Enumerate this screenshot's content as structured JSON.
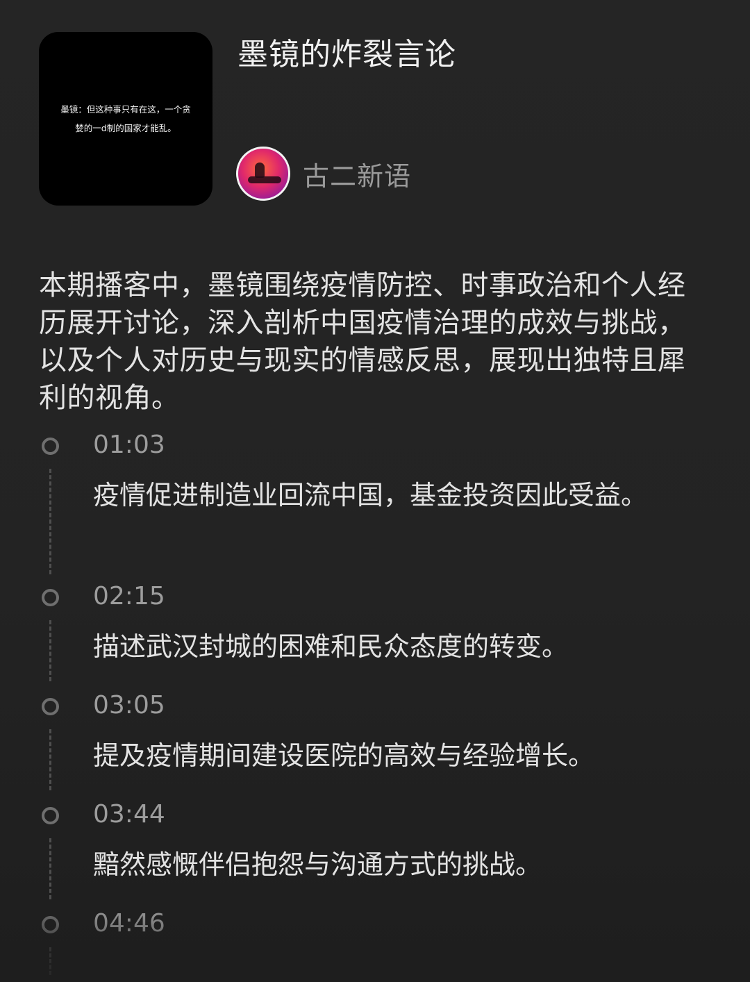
{
  "cover": {
    "text": "墨镜：但这种事只有在这，一个贪\n婪的一d制的国家才能乱。"
  },
  "episode": {
    "title": "墨镜的炸裂言论"
  },
  "author": {
    "name": "古二新语"
  },
  "description": "本期播客中，墨镜围绕疫情防控、时事政治和个人经历展开讨论，深入剖析中国疫情治理的成效与挑战，以及个人对历史与现实的情感反思，展现出独特且犀利的视角。",
  "chapters": [
    {
      "time": "01:03",
      "text": "疫情促进制造业回流中国，基金投资因此受益。"
    },
    {
      "time": "02:15",
      "text": "描述武汉封城的困难和民众态度的转变。"
    },
    {
      "time": "03:05",
      "text": "提及疫情期间建设医院的高效与经验增长。"
    },
    {
      "time": "03:44",
      "text": "黯然感慨伴侣抱怨与沟通方式的挑战。"
    },
    {
      "time": "04:46",
      "text": ""
    }
  ]
}
